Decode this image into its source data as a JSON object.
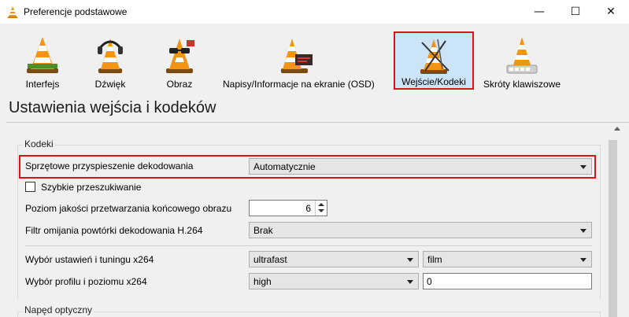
{
  "window": {
    "title": "Preferencje podstawowe",
    "controls": {
      "minimize": "—",
      "maximize": "☐",
      "close": "✕"
    }
  },
  "categories": [
    {
      "label": "Interfejs",
      "icon": "interface-cone-icon",
      "selected": false
    },
    {
      "label": "Dźwięk",
      "icon": "audio-headphones-cone-icon",
      "selected": false
    },
    {
      "label": "Obraz",
      "icon": "video-glasses-cone-icon",
      "selected": false
    },
    {
      "label": "Napisy/Informacje na ekranie (OSD)",
      "icon": "subtitles-cone-icon",
      "selected": false
    },
    {
      "label": "Wejście/Kodeki",
      "icon": "input-codecs-cone-icon",
      "selected": true
    },
    {
      "label": "Skróty klawiszowe",
      "icon": "hotkeys-cone-icon",
      "selected": false
    }
  ],
  "section_title": "Ustawienia wejścia i kodeków",
  "codecs": {
    "group_title": "Kodeki",
    "hw_decoding": {
      "label": "Sprzętowe przyspieszenie dekodowania",
      "value": "Automatycznie"
    },
    "fast_seek": {
      "label": "Szybkie przeszukiwanie",
      "checked": false
    },
    "postproc": {
      "label": "Poziom jakości przetwarzania końcowego obrazu",
      "value": "6"
    },
    "h264_loop": {
      "label": "Filtr omijania powtórki dekodowania H.264",
      "value": "Brak"
    },
    "x264_preset": {
      "label": "Wybór ustawień i tuningu x264",
      "preset": "ultrafast",
      "tune": "film"
    },
    "x264_profile": {
      "label": "Wybór profilu i poziomu x264",
      "profile": "high",
      "level": "0"
    }
  },
  "optical": {
    "group_title": "Napęd optyczny"
  },
  "colors": {
    "highlight": "#d8141b",
    "selected_bg": "#cce4f7"
  }
}
